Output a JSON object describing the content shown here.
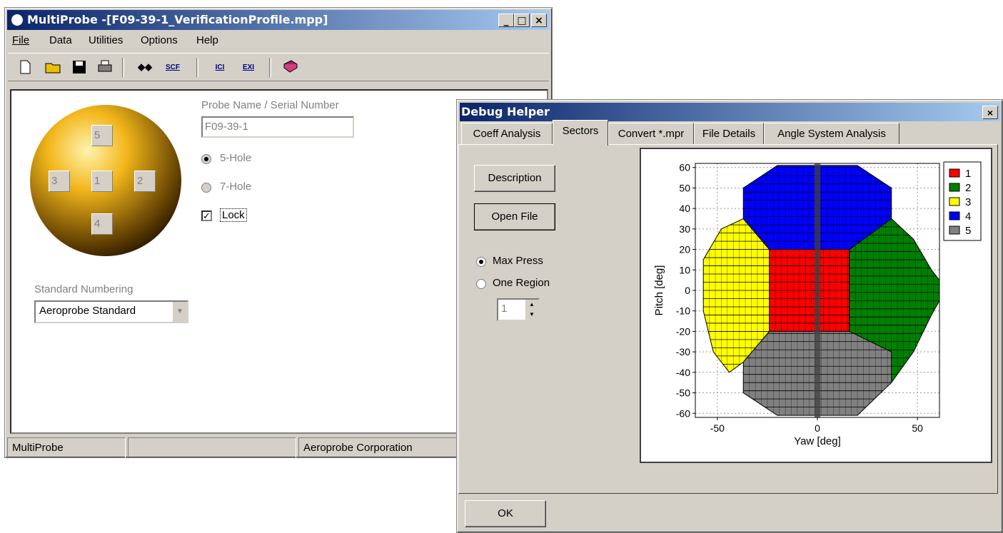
{
  "main_window": {
    "title": "MultiProbe -[F09-39-1_VerificationProfile.mpp]",
    "minimize": "_",
    "maximize": "□",
    "close": "×",
    "menu": [
      "File",
      "Data",
      "Utilities",
      "Options",
      "Help"
    ],
    "toolbar_icons": [
      "new-file-icon",
      "open-folder-icon",
      "save-disk-icon",
      "print-icon",
      "probe-icon",
      "scf-icon",
      "ici-icon",
      "exi-icon",
      "book-icon"
    ],
    "toolbar_text": {
      "scf": "SCF",
      "ici": "ICI",
      "exi": "EXI"
    },
    "probe_name_label": "Probe Name / Serial Number",
    "probe_name_value": "F09-39-1",
    "hole_options": [
      "5-Hole",
      "7-Hole"
    ],
    "lock_label": "Lock",
    "lock_checked": true,
    "holes": [
      "5",
      "3",
      "1",
      "2",
      "4"
    ],
    "numbering_label": "Standard Numbering",
    "numbering_value": "Aeroprobe Standard",
    "status": [
      "MultiProbe",
      "",
      "Aeroprobe Corporation"
    ],
    "colors": {
      "titlebar": "#0a246a",
      "sphere": "#f2b61a"
    }
  },
  "debug_window": {
    "title": "Debug Helper",
    "close": "×",
    "tabs": [
      "Coeff Analysis",
      "Sectors",
      "Convert *.mpr",
      "File Details",
      "Angle System Analysis"
    ],
    "active_tab": "Sectors",
    "description_button": "Description",
    "open_file_button": "Open File",
    "radio_options": [
      "Max Press",
      "One Region"
    ],
    "radio_selected": "Max Press",
    "region_value": "1",
    "ok_button": "OK"
  },
  "chart_data": {
    "type": "scatter",
    "xlabel": "Yaw [deg]",
    "ylabel": "Pitch [deg]",
    "xlim": [
      -61,
      61
    ],
    "ylim": [
      -62,
      62
    ],
    "x_ticks": [
      -50,
      0,
      50
    ],
    "y_ticks": [
      60,
      50,
      40,
      30,
      20,
      10,
      0,
      -10,
      -20,
      -30,
      -40,
      -50,
      -60
    ],
    "grid": true,
    "legend_position": "top-right",
    "series": [
      {
        "name": "1",
        "color": "#ff0000",
        "region": "center",
        "yaw": [
          -24,
          16
        ],
        "pitch": [
          -20,
          20
        ]
      },
      {
        "name": "2",
        "color": "#008000",
        "region": "right",
        "yaw": [
          16,
          61
        ],
        "pitch": [
          -50,
          40
        ]
      },
      {
        "name": "3",
        "color": "#ffff00",
        "region": "left",
        "yaw": [
          -57,
          -24
        ],
        "pitch": [
          -45,
          35
        ]
      },
      {
        "name": "4",
        "color": "#0000ff",
        "region": "top",
        "yaw": [
          -37,
          37
        ],
        "pitch": [
          20,
          62
        ]
      },
      {
        "name": "5",
        "color": "#808080",
        "region": "bottom",
        "yaw": [
          -37,
          37
        ],
        "pitch": [
          -62,
          -20
        ]
      }
    ]
  }
}
